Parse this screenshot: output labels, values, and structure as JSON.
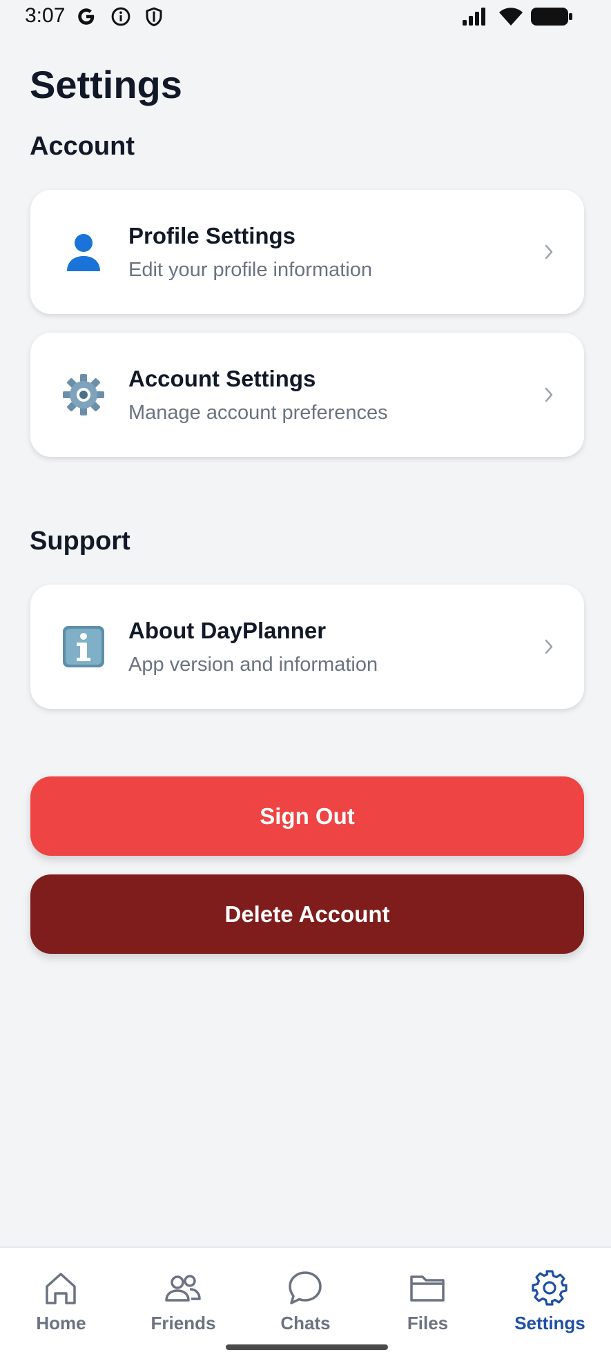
{
  "status_bar": {
    "time": "3:07"
  },
  "page": {
    "title": "Settings"
  },
  "sections": {
    "account": {
      "title": "Account",
      "items": [
        {
          "title": "Profile Settings",
          "subtitle": "Edit your profile information",
          "icon": "person-icon"
        },
        {
          "title": "Account Settings",
          "subtitle": "Manage account preferences",
          "icon": "gear-icon"
        }
      ]
    },
    "support": {
      "title": "Support",
      "items": [
        {
          "title": "About DayPlanner",
          "subtitle": "App version and information",
          "icon": "info-icon"
        }
      ]
    }
  },
  "buttons": {
    "sign_out": "Sign Out",
    "delete_account": "Delete Account"
  },
  "bottom_nav": {
    "active": "Settings",
    "items": [
      {
        "label": "Home",
        "icon": "home-icon"
      },
      {
        "label": "Friends",
        "icon": "friends-icon"
      },
      {
        "label": "Chats",
        "icon": "chat-icon"
      },
      {
        "label": "Files",
        "icon": "folder-icon"
      },
      {
        "label": "Settings",
        "icon": "settings-icon"
      }
    ]
  },
  "colors": {
    "background": "#f3f4f6",
    "sign_out": "#ef4444",
    "delete_account": "#7f1d1d",
    "nav_active": "#1e4fa3",
    "nav_inactive": "#6b7280"
  }
}
